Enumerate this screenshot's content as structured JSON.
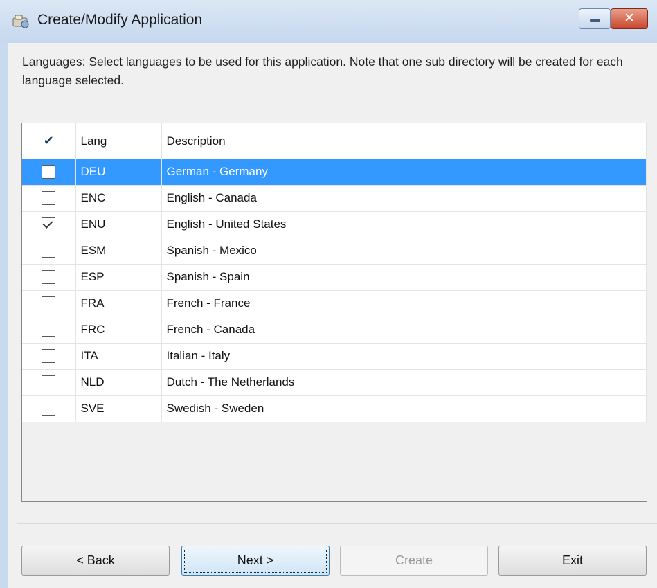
{
  "window": {
    "title": "Create/Modify Application",
    "title_icon": "application-icon",
    "minimize_icon": "minimize-icon",
    "close_icon": "close-icon",
    "close_glyph": "✕"
  },
  "instructions": "Languages: Select languages to be used for this application.  Note that one sub directory will be created for each language selected.",
  "table": {
    "header_check_glyph": "✔",
    "columns": [
      "Lang",
      "Description"
    ],
    "rows": [
      {
        "checked": false,
        "lang": "DEU",
        "description": "German - Germany",
        "selected": true
      },
      {
        "checked": false,
        "lang": "ENC",
        "description": "English - Canada",
        "selected": false
      },
      {
        "checked": true,
        "lang": "ENU",
        "description": "English - United States",
        "selected": false
      },
      {
        "checked": false,
        "lang": "ESM",
        "description": "Spanish - Mexico",
        "selected": false
      },
      {
        "checked": false,
        "lang": "ESP",
        "description": "Spanish - Spain",
        "selected": false
      },
      {
        "checked": false,
        "lang": "FRA",
        "description": "French - France",
        "selected": false
      },
      {
        "checked": false,
        "lang": "FRC",
        "description": "French - Canada",
        "selected": false
      },
      {
        "checked": false,
        "lang": "ITA",
        "description": "Italian - Italy",
        "selected": false
      },
      {
        "checked": false,
        "lang": "NLD",
        "description": "Dutch - The Netherlands",
        "selected": false
      },
      {
        "checked": false,
        "lang": "SVE",
        "description": "Swedish - Sweden",
        "selected": false
      }
    ]
  },
  "buttons": {
    "back": "< Back",
    "next": "Next >",
    "create": "Create",
    "create_enabled": false,
    "exit": "Exit"
  },
  "colors": {
    "selection": "#3399ff",
    "titlebar": "#c6d8ee",
    "close_button": "#c8452b"
  }
}
